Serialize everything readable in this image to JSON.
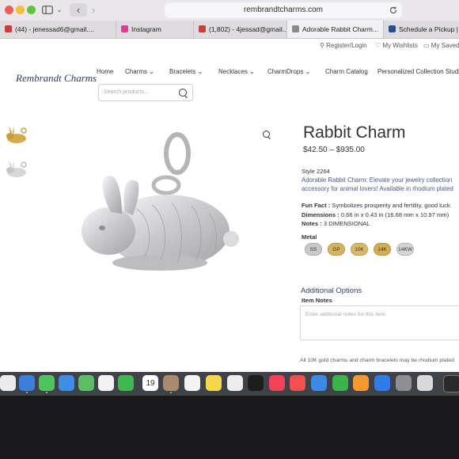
{
  "browser": {
    "url": "rembrandtcharms.com",
    "tabs": [
      {
        "label": "(44) - jenessad6@gmail....",
        "fav": "#c9403a"
      },
      {
        "label": "Instagram",
        "fav": "#d6409a"
      },
      {
        "label": "(1,802) - 4jessad@gmail....",
        "fav": "#c9403a"
      },
      {
        "label": "Adorable Rabbit Charm...",
        "fav": "#3a63a3"
      },
      {
        "label": "Schedule a Pickup | USPS",
        "fav": "#2a4f8f"
      }
    ]
  },
  "utility": {
    "register_login": "Register/Login",
    "wishlists": "My Wishlists",
    "saved": "My Saved"
  },
  "logo": "Rembrandt Charms",
  "nav": [
    "Home",
    "Charms",
    "Bracelets",
    "Necklaces",
    "CharmDrops",
    "Charm Catalog",
    "Personalized Collection Studio"
  ],
  "search": {
    "placeholder": "Search products..."
  },
  "product": {
    "title": "Rabbit Charm",
    "price": "$42.50 – $935.00",
    "style": "Style 2264",
    "desc_line1": "Adorable Rabbit Charm: Elevate your jewelry collection",
    "desc_line2": "accessory for animal lovers! Available in rhodium plated",
    "fun_fact_label": "Fun Fact :",
    "fun_fact": "Symbolizes prosperity and fertility, good luck.",
    "dimensions_label": "Dimensions :",
    "dimensions": "0.66 in x 0.43 in (16.68 mm x 10.97 mm)",
    "notes_label": "Notes :",
    "notes": "3 DIMENSIONAL",
    "metal_label": "Metal",
    "metals": [
      {
        "label": "SS",
        "color": "#c9c9c9"
      },
      {
        "label": "GP",
        "color": "#d6b45a"
      },
      {
        "label": "10K",
        "color": "#d9b867"
      },
      {
        "label": "14K",
        "color": "#d3ad4f"
      },
      {
        "label": "14KW",
        "color": "#d4d4d6"
      }
    ]
  },
  "additional": {
    "heading": "Additional Options",
    "item_notes_label": "Item Notes",
    "item_notes_placeholder": "Enter addtional notes for this item"
  },
  "footer_note": "All 10K gold charms and charm bracelets may be rhodium plated",
  "dock": {
    "calendar_day": "19"
  }
}
